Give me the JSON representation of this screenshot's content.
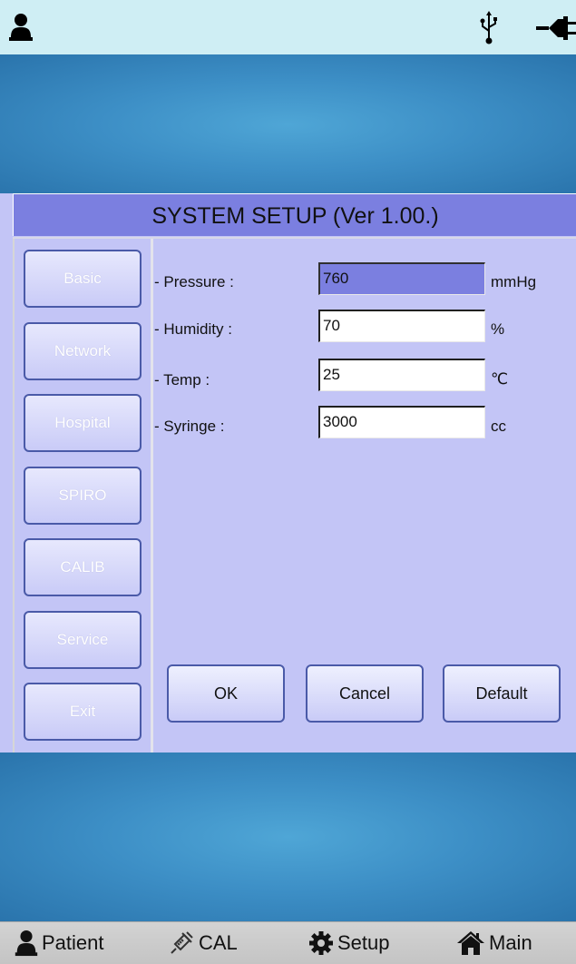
{
  "status_bar": {
    "left_icon": "user-icon",
    "right_icons": [
      "usb-icon",
      "power-plug-icon"
    ]
  },
  "dialog": {
    "title": "SYSTEM SETUP (Ver 1.00.)",
    "side_menu": [
      {
        "label": "Basic",
        "icon": null
      },
      {
        "label": "Network",
        "icon": null
      },
      {
        "label": "Hospital",
        "icon": null
      },
      {
        "label": "SPIRO",
        "icon": null
      },
      {
        "label": "CALIB",
        "icon": null
      },
      {
        "label": "Service",
        "icon": null
      },
      {
        "label": "Exit",
        "icon": null
      }
    ],
    "fields": [
      {
        "label": "- Pressure :",
        "value": "760",
        "unit": "mmHg",
        "active": true
      },
      {
        "label": "- Humidity :",
        "value": "70",
        "unit": "%",
        "active": false
      },
      {
        "label": "- Temp :",
        "value": "25",
        "unit": "℃",
        "active": false
      },
      {
        "label": "- Syringe :",
        "value": "3000",
        "unit": "cc",
        "active": false
      }
    ],
    "buttons": {
      "ok": "OK",
      "cancel": "Cancel",
      "default": "Default"
    }
  },
  "bottom_nav": [
    {
      "label": "Patient",
      "icon": "person-icon"
    },
    {
      "label": "CAL",
      "icon": "syringe-icon"
    },
    {
      "label": "Setup",
      "icon": "gear-icon"
    },
    {
      "label": "Main",
      "icon": "home-icon"
    }
  ],
  "colors": {
    "status_bar": "#cfeef4",
    "dialog_background": "#c3c5f6",
    "title_bar": "#7b7fe0",
    "active_field": "#7b7fe0",
    "button_border": "#4a5aa8",
    "background_blue": "#3d8fc6"
  }
}
